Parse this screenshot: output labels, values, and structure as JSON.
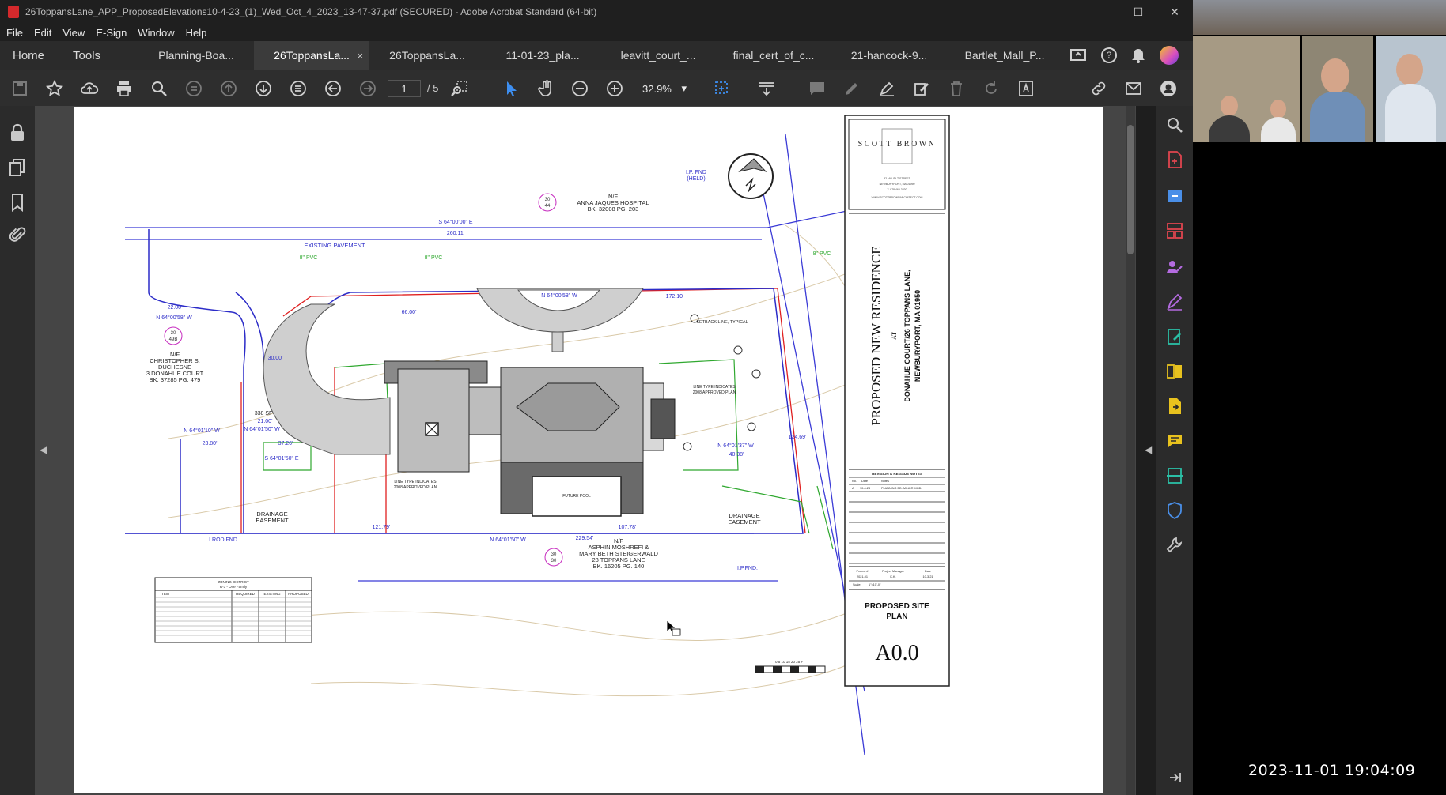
{
  "window": {
    "title": "26ToppansLane_APP_ProposedElevations10-4-23_(1)_Wed_Oct_4_2023_13-47-37.pdf (SECURED) - Adobe Acrobat Standard (64-bit)",
    "min_glyph": "—",
    "max_glyph": "☐",
    "close_glyph": "✕"
  },
  "menu": [
    "File",
    "Edit",
    "View",
    "E-Sign",
    "Window",
    "Help"
  ],
  "tabs": {
    "home": "Home",
    "tools": "Tools",
    "docs": [
      "Planning-Boa...",
      "26ToppansLa...",
      "26ToppansLa...",
      "11-01-23_pla...",
      "leavitt_court_...",
      "final_cert_of_c...",
      "21-hancock-9...",
      "Bartlet_Mall_P..."
    ],
    "close_glyph": "×"
  },
  "toolbar": {
    "page_current": "1",
    "page_total": "/ 5",
    "zoom": "32.9%",
    "zoom_caret": "▾"
  },
  "plan": {
    "abutter_top": [
      "N/F",
      "ANNA JAQUES HOSPITAL",
      "BK. 32008 PG. 203"
    ],
    "abutter_left": [
      "N/F",
      "CHRISTOPHER S.",
      "DUCHESNE",
      "3 DONAHUE COURT",
      "BK. 37285 PG. 479"
    ],
    "abutter_bottom": [
      "N/F",
      "ASPHIN MOSHREFI &",
      "MARY BETH STEIGERWALD",
      "28 TOPPANS LANE",
      "BK. 16205 PG. 140"
    ],
    "existing_pavement": "EXISTING PAVEMENT",
    "ip_fnd": [
      "I.P. FND",
      "(HELD)"
    ],
    "iron_rod": "I.ROD FND.",
    "ip_fnd_br": "I.P.FND.",
    "drainage_left": [
      "DRAINAGE",
      "EASEMENT"
    ],
    "drainage_right": [
      "DRAINAGE",
      "EASEMENT"
    ],
    "setback_line": "SETBACK LINE, TYPICAL",
    "line_type_right": [
      "LINE TYPE INDICATES",
      "2008 APPROVED PLAN"
    ],
    "line_type_left": [
      "LINE TYPE INDICATES",
      "2008 APPROVED PLAN"
    ],
    "future_pool": "FUTURE POOL",
    "bearings": [
      "S 64°00'00\" E",
      "N 64°00'58\" W",
      "N 64°01'37\" W",
      "N 64°01'50\" W",
      "N 64°00'58\" W",
      "N 64°01'10\" W",
      "S 64°01'50\" E",
      "N 64°01'50\" W"
    ],
    "distances": [
      "260.11'",
      "66.00'",
      "172.10'",
      "121.79'",
      "107.78'",
      "229.54'",
      "30.00'",
      "22.00'",
      "21.00'",
      "37.26'",
      "23.80'",
      "40.38'",
      "124.69'"
    ],
    "parcel_top": [
      "30",
      "44"
    ],
    "parcel_left": [
      "30",
      "49B"
    ],
    "parcel_bottom": [
      "30",
      "30"
    ],
    "area_label": "338 SF",
    "pvc_labels": [
      "8\" PVC",
      "8\" PVC",
      "8\" PVC"
    ],
    "zoning_title": [
      "ZONING DISTRICT",
      "R-3 - One Family"
    ],
    "zoning_headers": [
      "ITEM",
      "REQUIRED",
      "EXISTING",
      "PROPOSED"
    ],
    "scale_bar": "0 5 10 15 20 25 FT"
  },
  "titleblock": {
    "firm": "SCOTT BROWN",
    "firm_address": [
      "32 MAUDLT STREET",
      "NEWBURYPORT, MA 01950",
      "T: 978.465.3830",
      "WWW.SCOTTBROWNARCHITECT.COM"
    ],
    "project_title": "PROPOSED NEW RESIDENCE",
    "at": "AT",
    "address_1": "DONAHUE COURT/26 TOPPANS LANE,",
    "address_2": "NEWBURYPORT, MA 01950",
    "revisions_header": "REVISION & REISSUE NOTES",
    "revisions_cols": [
      "No.",
      "Date",
      "Notes"
    ],
    "revision_row": [
      "A",
      "10-4-23",
      "PLANNING BD. MINOR MOD."
    ],
    "project_no_label": "Project #",
    "project_no": "2021-01",
    "manager_label": "Project Manager",
    "manager": "K.K.",
    "date_label": "Date",
    "date": "10-3-21",
    "scale_label": "Scale:",
    "scale": "1\"=10'-0\"",
    "sheet_title_1": "PROPOSED SITE",
    "sheet_title_2": "PLAN",
    "sheet_no": "A0.0"
  },
  "video": {
    "timestamp": "2023-11-01 19:04:09"
  },
  "colors": {
    "accent_blue": "#3d8ef0",
    "acrobat_red": "#d4292c",
    "plan_blue": "#3b3bd6",
    "plan_red": "#e02020",
    "plan_green": "#2fa82f",
    "right_rail_icon_red": "#e0454f",
    "right_rail_icon_blue": "#4a8fe8",
    "right_rail_icon_purple": "#b46be0",
    "right_rail_icon_teal": "#2bbfa6",
    "right_rail_icon_yellow": "#e8c21e"
  }
}
